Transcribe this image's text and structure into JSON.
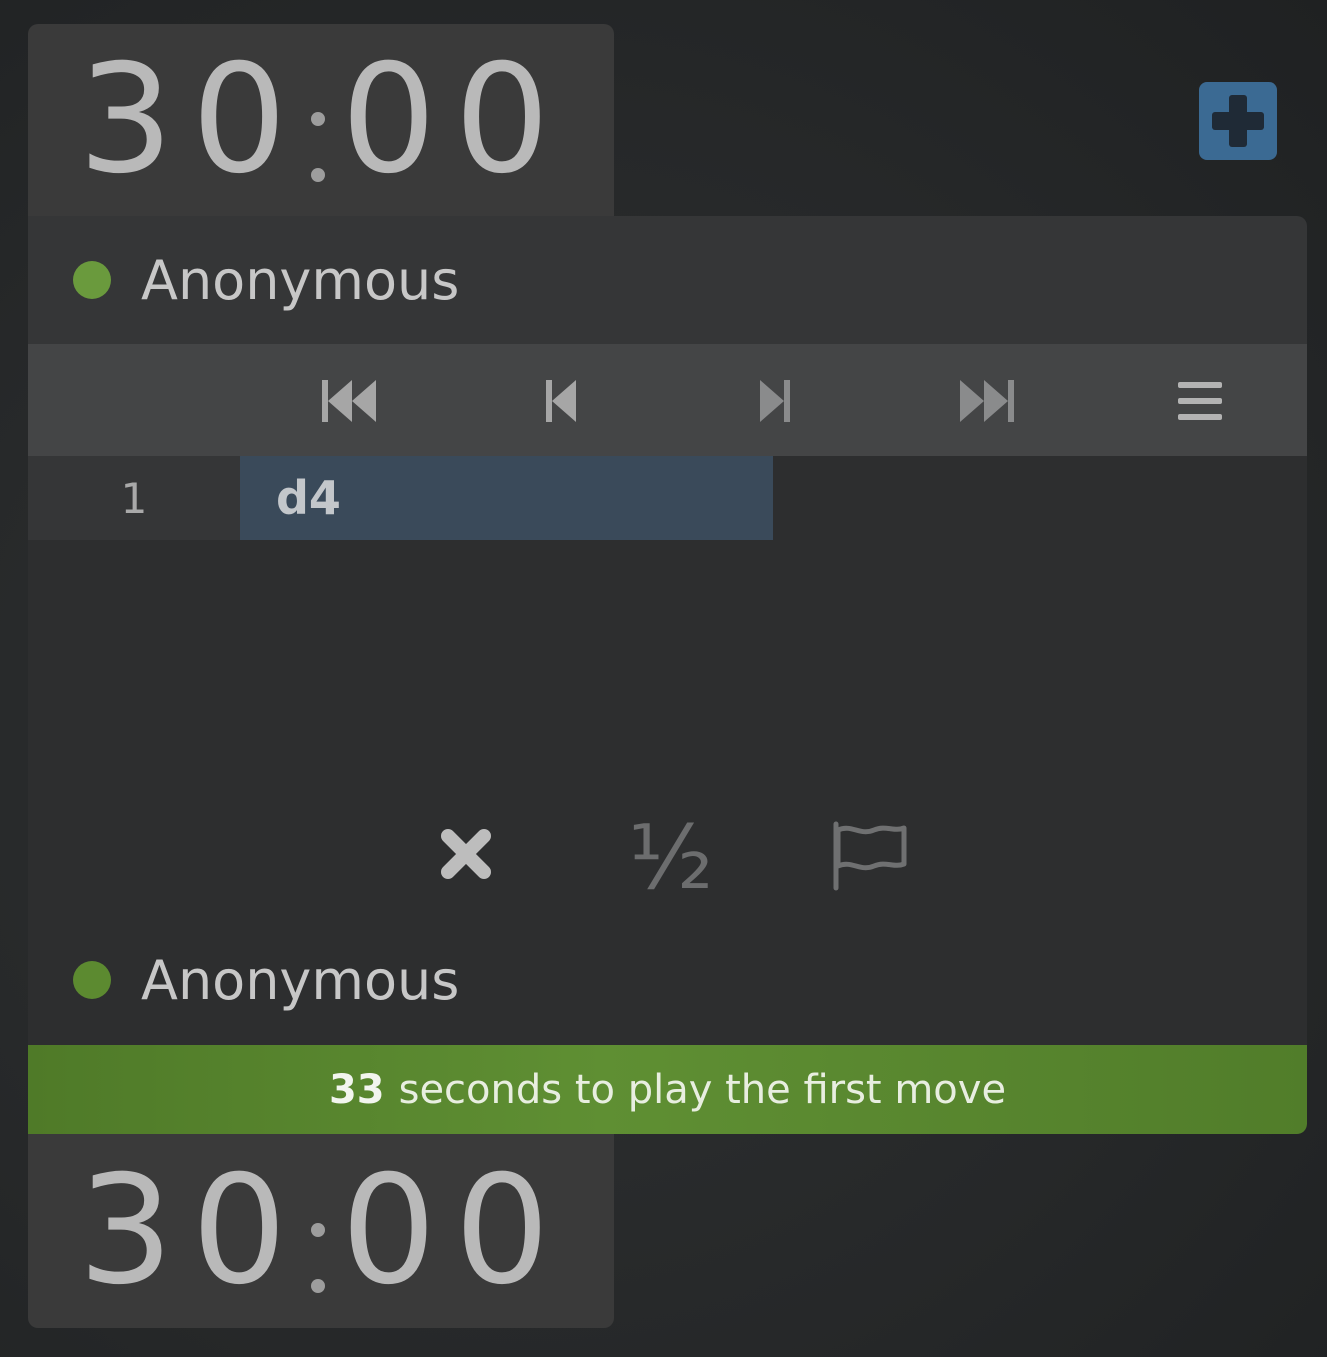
{
  "clocks": {
    "top": {
      "minutes": "30",
      "seconds": "00"
    },
    "bottom": {
      "minutes": "30",
      "seconds": "00"
    }
  },
  "players": {
    "top": {
      "name": "Anonymous",
      "status": "online"
    },
    "bottom": {
      "name": "Anonymous",
      "status": "online"
    }
  },
  "controls_icons": {
    "add": "plus-icon",
    "first": "first-move-icon",
    "prev": "prev-move-icon",
    "next": "next-move-icon",
    "last": "last-move-icon",
    "menu": "menu-icon",
    "abort": "x-icon",
    "draw": "half-icon",
    "resign": "flag-icon"
  },
  "moves": [
    {
      "number": "1",
      "white": "d4"
    }
  ],
  "draw_label": "½",
  "banner": {
    "count": "33",
    "text": "seconds to play the first move"
  },
  "colors": {
    "accent": "#3b6a93",
    "online_dot": "#6a9a3d",
    "banner_green": "#5f8f33",
    "selected_move": "#3a4a5a"
  }
}
